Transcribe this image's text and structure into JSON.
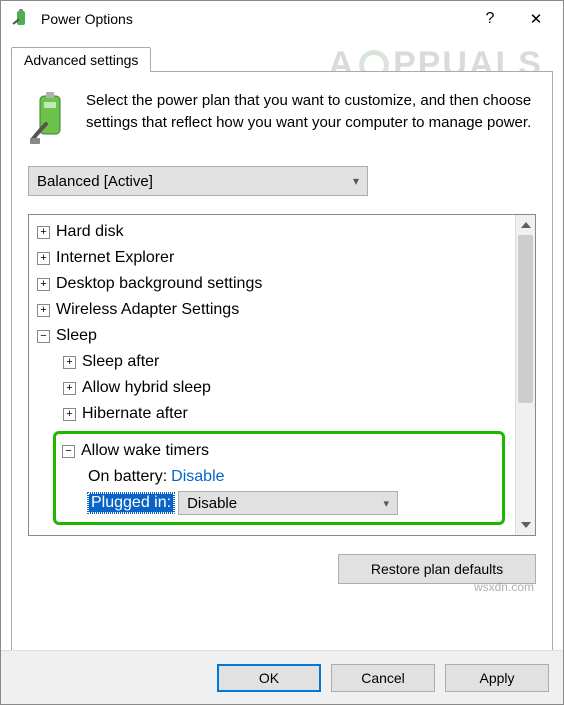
{
  "window": {
    "title": "Power Options",
    "help": "?",
    "close": "✕"
  },
  "tab": {
    "label": "Advanced settings"
  },
  "intro": "Select the power plan that you want to customize, and then choose settings that reflect how you want your computer to manage power.",
  "plan": {
    "selected": "Balanced [Active]"
  },
  "tree": {
    "items": [
      {
        "expand": "+",
        "label": "Hard disk"
      },
      {
        "expand": "+",
        "label": "Internet Explorer"
      },
      {
        "expand": "+",
        "label": "Desktop background settings"
      },
      {
        "expand": "+",
        "label": "Wireless Adapter Settings"
      },
      {
        "expand": "−",
        "label": "Sleep"
      }
    ],
    "sleep_children": [
      {
        "expand": "+",
        "label": "Sleep after"
      },
      {
        "expand": "+",
        "label": "Allow hybrid sleep"
      },
      {
        "expand": "+",
        "label": "Hibernate after"
      }
    ],
    "wake": {
      "expand": "−",
      "label": "Allow wake timers",
      "battery_label": "On battery:",
      "battery_value": "Disable",
      "plugged_label": "Plugged in:",
      "plugged_value": "Disable"
    }
  },
  "restore": "Restore plan defaults",
  "buttons": {
    "ok": "OK",
    "cancel": "Cancel",
    "apply": "Apply"
  },
  "watermark": {
    "pre": "A",
    "post": "PPUALS"
  },
  "footer_wm": "wsxdn.com"
}
